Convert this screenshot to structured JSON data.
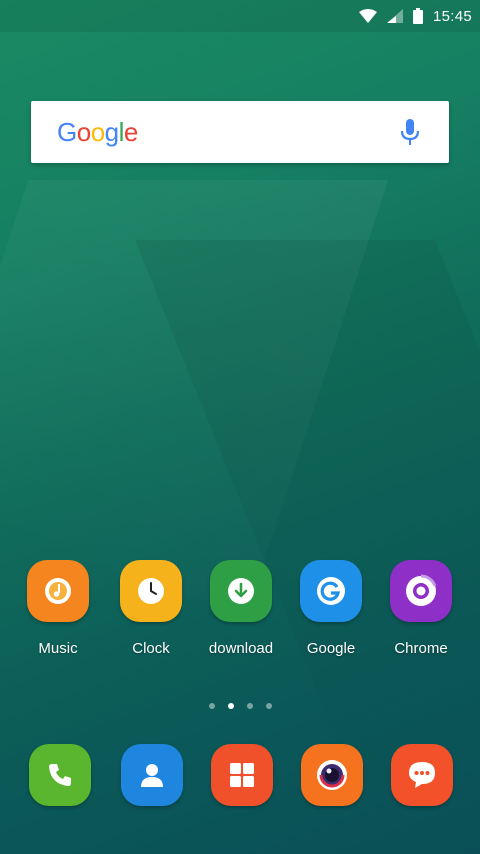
{
  "status_bar": {
    "time": "15:45"
  },
  "search": {
    "logo_letters": [
      "G",
      "o",
      "o",
      "g",
      "l",
      "e"
    ]
  },
  "apps": [
    {
      "label": "Music",
      "icon": "music-icon",
      "color": "#f5851e"
    },
    {
      "label": "Clock",
      "icon": "clock-icon",
      "color": "#f5b21a"
    },
    {
      "label": "download",
      "icon": "download-icon",
      "color": "#2e9f45"
    },
    {
      "label": "Google",
      "icon": "google-g-icon",
      "color": "#1e90e8"
    },
    {
      "label": "Chrome",
      "icon": "chrome-icon",
      "color": "#8e2fc8"
    }
  ],
  "page_indicator": {
    "pages": 4,
    "active": 1
  },
  "dock": [
    {
      "icon": "phone-icon",
      "color": "#5ab52f"
    },
    {
      "icon": "contacts-icon",
      "color": "#1f86e0"
    },
    {
      "icon": "apps-grid-icon",
      "color": "#f0512a"
    },
    {
      "icon": "camera-icon",
      "color": "#f5731e"
    },
    {
      "icon": "messages-icon",
      "color": "#f2512a"
    }
  ],
  "colors": {
    "google_blue": "#4285f4",
    "google_red": "#ea4335",
    "google_yellow": "#fbbc05",
    "google_green": "#34a853"
  }
}
